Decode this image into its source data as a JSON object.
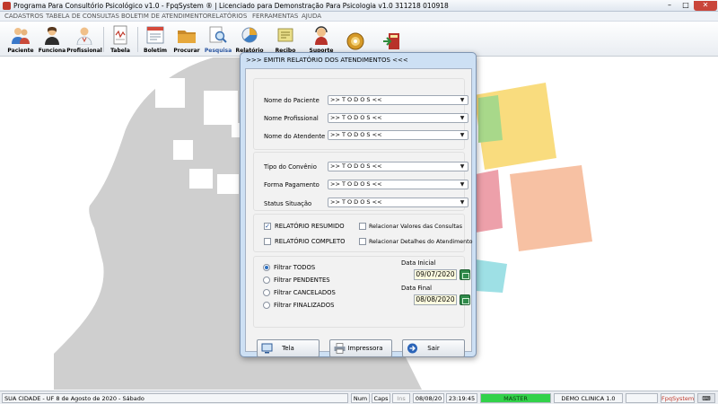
{
  "window": {
    "title": "Programa Para Consultório Psicológico v1.0 - FpqSystem ® | Licenciado para  Demonstração Para Psicologia v1.0 311218 010918",
    "min_icon": "minimize-icon",
    "max_icon": "maximize-icon",
    "close_icon": "close-icon"
  },
  "menu": [
    "CADASTROS",
    "TABELA DE CONSULTAS",
    "BOLETIM DE ATENDIMENTO",
    "RELATÓRIOS",
    "FERRAMENTAS",
    "AJUDA"
  ],
  "toolbar": [
    {
      "label": "Paciente",
      "icon": "patient-icon"
    },
    {
      "label": "Funciona",
      "icon": "employee-icon"
    },
    {
      "label": "Profissional",
      "icon": "doctor-icon"
    },
    {
      "label": "Tabela",
      "icon": "table-icon"
    },
    {
      "label": "Boletim",
      "icon": "bulletin-icon"
    },
    {
      "label": "Procurar",
      "icon": "folder-icon"
    },
    {
      "label": "Pesquisa",
      "icon": "search-icon"
    },
    {
      "label": "Relatório",
      "icon": "report-icon"
    },
    {
      "label": "Recibo",
      "icon": "receipt-icon"
    },
    {
      "label": "Suporte",
      "icon": "support-icon"
    },
    {
      "label": "",
      "icon": "backup-disc-icon"
    },
    {
      "label": "",
      "icon": "exit-icon"
    }
  ],
  "dialog": {
    "title": ">>>  EMITIR RELATÓRIO DOS ATENDIMENTOS  <<<",
    "filters": {
      "patient_label": "Nome do Paciente",
      "patient_value": ">> T O D O S <<",
      "professional_label": "Nome Profissional",
      "professional_value": ">> T O D O S <<",
      "attendant_label": "Nome do Atendente",
      "attendant_value": ">> T O D O S <<",
      "agreement_label": "Tipo do Convênio",
      "agreement_value": ">> T O D O S <<",
      "payment_label": "Forma Pagamento",
      "payment_value": ">> T O D O S <<",
      "status_label": "Status Situação",
      "status_value": ">> T O D O S <<"
    },
    "options": {
      "summary_label": "RELATÓRIO RESUMIDO",
      "summary_checked": true,
      "full_label": "RELATÓRIO COMPLETO",
      "full_checked": false,
      "values_label": "Relacionar Valores das Consultas",
      "values_checked": false,
      "details_label": "Relacionar Detalhes do Atendimento",
      "details_checked": false
    },
    "period": {
      "radios": [
        "Filtrar TODOS",
        "Filtrar PENDENTES",
        "Filtrar CANCELADOS",
        "Filtrar FINALIZADOS"
      ],
      "selected": "Filtrar TODOS",
      "start_label": "Data Inicial",
      "start_value": "09/07/2020",
      "end_label": "Data Final",
      "end_value": "08/08/2020"
    },
    "buttons": {
      "screen": "Tela",
      "printer": "Impressora",
      "exit": "Sair"
    }
  },
  "status": {
    "location": "SUA CIDADE - UF  8 de Agosto de 2020 - Sábado",
    "num": "Num",
    "caps": "Caps",
    "ins": "Ins",
    "date": "08/08/20",
    "time": "23:19:45",
    "mode": "MASTER",
    "clinic": "DEMO CLINICA 1.0",
    "brand": "FpqSystem",
    "colors": {
      "mode_bg": "#32d24a",
      "brand": "#c0392b"
    }
  }
}
